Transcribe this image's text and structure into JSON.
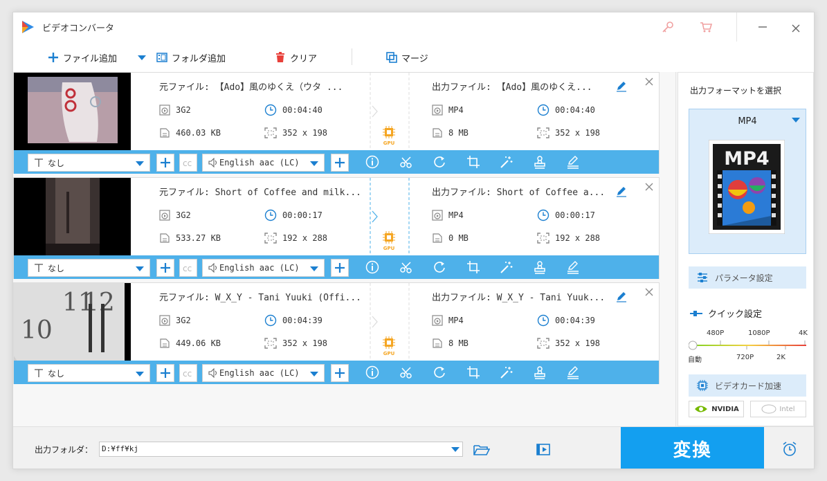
{
  "window": {
    "title": "ビデオコンバータ"
  },
  "toolbar": {
    "add_file": "ファイル追加",
    "add_folder": "フォルダ追加",
    "clear": "クリア",
    "merge": "マージ"
  },
  "items": [
    {
      "src_name": "元ファイル: 【Ado】風のゆくえ（ウタ ...",
      "src_format": "3G2",
      "src_duration": "00:04:40",
      "src_size": "460.03 KB",
      "src_res": "352 x 198",
      "dst_name": "出力ファイル: 【Ado】風のゆくえ...",
      "dst_format": "MP4",
      "dst_duration": "00:04:40",
      "dst_size": "8 MB",
      "dst_res": "352 x 198",
      "subtitle": "なし",
      "audio": "English aac (LC)",
      "gpu_label": "GPU"
    },
    {
      "src_name": "元ファイル: Short of Coffee and milk...",
      "src_format": "3G2",
      "src_duration": "00:00:17",
      "src_size": "533.27 KB",
      "src_res": "192 x 288",
      "dst_name": "出力ファイル: Short of Coffee a...",
      "dst_format": "MP4",
      "dst_duration": "00:00:17",
      "dst_size": "0 MB",
      "dst_res": "192 x 288",
      "subtitle": "なし",
      "audio": "English aac (LC)",
      "gpu_label": "GPU"
    },
    {
      "src_name": "元ファイル: W_X_Y - Tani Yuuki (Offi...",
      "src_format": "3G2",
      "src_duration": "00:04:39",
      "src_size": "449.06 KB",
      "src_res": "352 x 198",
      "dst_name": "出力ファイル: W_X_Y - Tani Yuuk...",
      "dst_format": "MP4",
      "dst_duration": "00:04:39",
      "dst_size": "8 MB",
      "dst_res": "352 x 198",
      "subtitle": "なし",
      "audio": "English aac (LC)",
      "gpu_label": "GPU"
    }
  ],
  "right_panel": {
    "title": "出力フォーマットを選択",
    "format": "MP4",
    "format_badge": "MP4",
    "params": "パラメータ設定",
    "quick": "クイック設定",
    "res_top": [
      "480P",
      "1080P",
      "4K"
    ],
    "res_bottom": [
      "自動",
      "720P",
      "2K"
    ],
    "quality_level": 0,
    "gpu_accel": "ビデオカード加速",
    "nvidia": "NVIDIA",
    "intel": "Intel"
  },
  "bottom": {
    "output_label": "出力フォルダ：",
    "output_path": "D:¥ff¥kj",
    "convert": "変換"
  },
  "colors": {
    "accent": "#139ff0",
    "bar": "#4eb1ea",
    "icon": "#1b7fd0"
  }
}
